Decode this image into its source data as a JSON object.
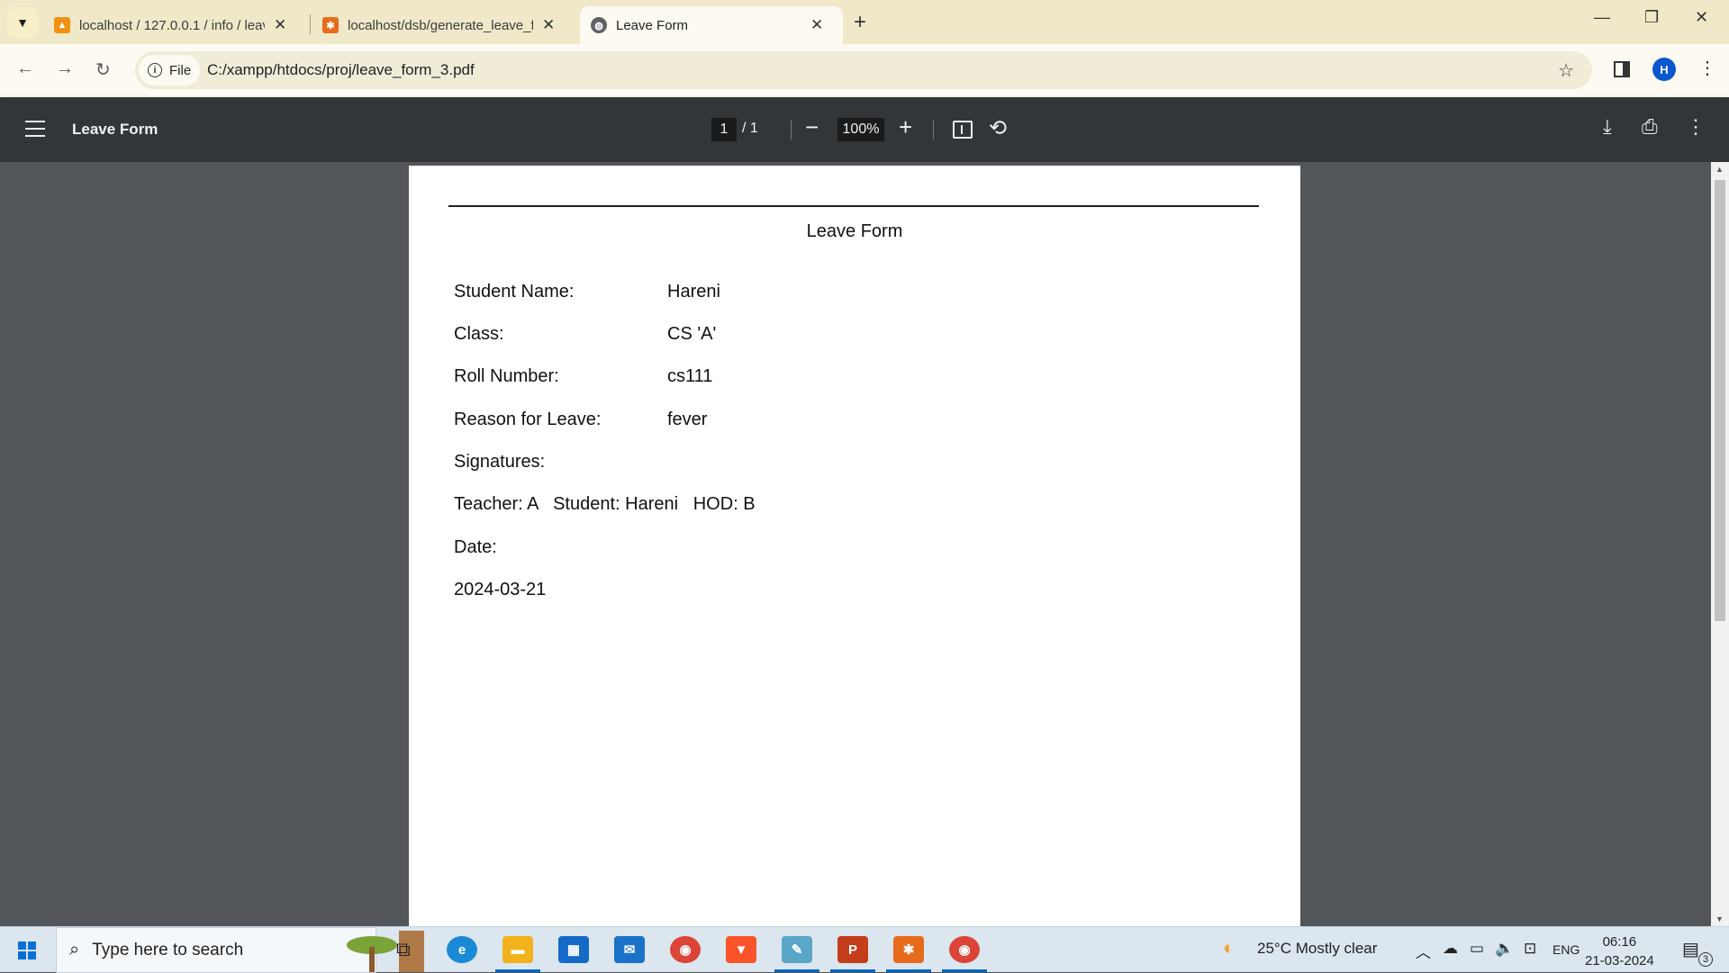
{
  "browser": {
    "tabs": [
      {
        "title": "localhost / 127.0.0.1 / info / leave",
        "icon": "phpmyadmin-icon",
        "active": false
      },
      {
        "title": "localhost/dsb/generate_leave_form",
        "icon": "xampp-icon",
        "active": false
      },
      {
        "title": "Leave Form",
        "icon": "globe-icon",
        "active": true
      }
    ],
    "address": {
      "scheme_chip": "File",
      "url": "C:/xampp/htdocs/proj/leave_form_3.pdf"
    },
    "profile_initial": "H"
  },
  "pdf_viewer": {
    "title": "Leave Form",
    "page_current": "1",
    "page_total": "/  1",
    "zoom": "100%"
  },
  "document": {
    "heading": "Leave Form",
    "fields": [
      {
        "label": "Student Name:",
        "value": "Hareni"
      },
      {
        "label": "Class:",
        "value": "CS 'A'"
      },
      {
        "label": "Roll Number:",
        "value": "cs111"
      },
      {
        "label": "Reason for Leave:",
        "value": "fever"
      }
    ],
    "signatures_label": "Signatures:",
    "signatures_line": "Teacher: A   Student: Hareni   HOD: B",
    "date_label": "Date:",
    "date_value": "2024-03-21"
  },
  "taskbar": {
    "search_placeholder": "Type here to search",
    "weather": "25°C  Mostly clear",
    "language": "ENG",
    "time": "06:16",
    "date": "21-03-2024",
    "notifications": "3"
  }
}
